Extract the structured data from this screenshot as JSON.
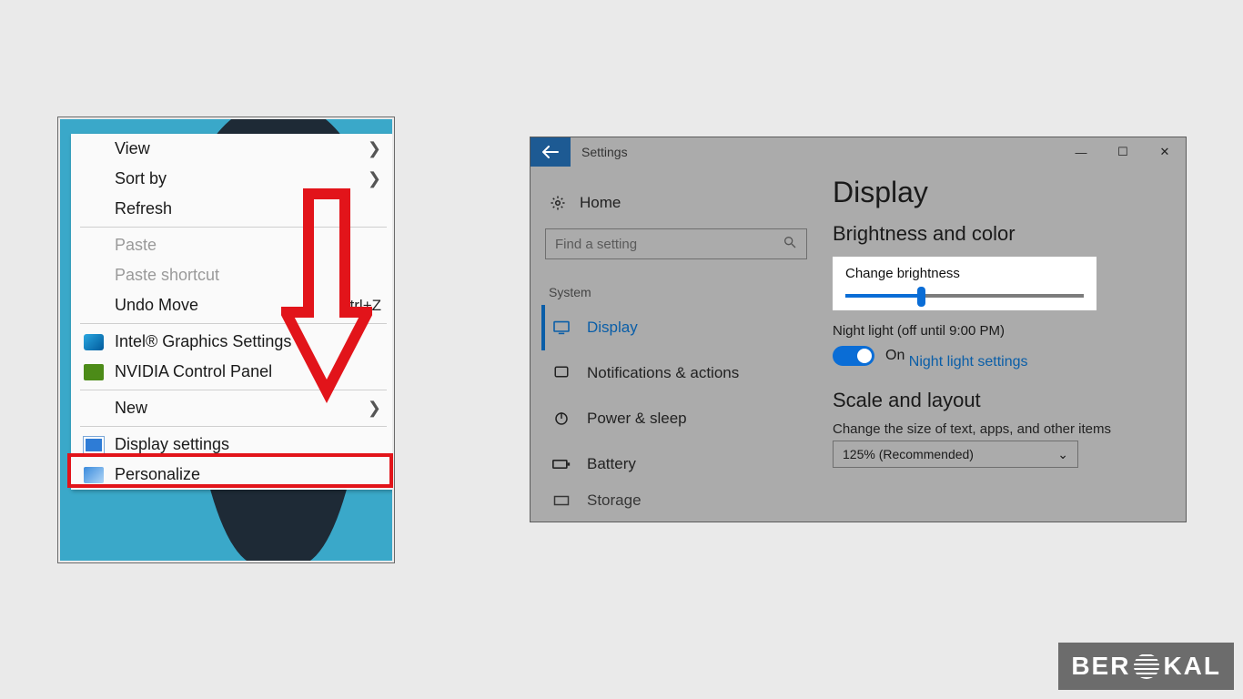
{
  "context_menu": {
    "items": [
      {
        "label": "View",
        "has_submenu": true
      },
      {
        "label": "Sort by",
        "has_submenu": true
      },
      {
        "label": "Refresh"
      }
    ],
    "items2": [
      {
        "label": "Paste",
        "disabled": true
      },
      {
        "label": "Paste shortcut",
        "disabled": true
      },
      {
        "label": "Undo Move",
        "shortcut": "Ctrl+Z"
      }
    ],
    "items3": [
      {
        "label": "Intel® Graphics Settings",
        "icon": "intel"
      },
      {
        "label": "NVIDIA Control Panel",
        "icon": "nvidia"
      }
    ],
    "items4": [
      {
        "label": "New",
        "has_submenu": true
      }
    ],
    "items5": [
      {
        "label": "Display settings",
        "icon": "display",
        "highlighted": true
      },
      {
        "label": "Personalize",
        "icon": "pers"
      }
    ]
  },
  "settings": {
    "title": "Settings",
    "home": "Home",
    "search_placeholder": "Find a setting",
    "category": "System",
    "nav": [
      {
        "label": "Display",
        "active": true,
        "icon": "monitor"
      },
      {
        "label": "Notifications & actions",
        "icon": "notif"
      },
      {
        "label": "Power & sleep",
        "icon": "power"
      },
      {
        "label": "Battery",
        "icon": "battery"
      },
      {
        "label": "Storage",
        "icon": "storage"
      }
    ],
    "page_heading": "Display",
    "section1": "Brightness and color",
    "brightness_label": "Change brightness",
    "brightness_percent": 30,
    "night_light_label": "Night light (off until 9:00 PM)",
    "toggle_state": "On",
    "night_light_link": "Night light settings",
    "section2": "Scale and layout",
    "scale_desc": "Change the size of text, apps, and other items",
    "scale_value": "125% (Recommended)"
  },
  "watermark": {
    "prefix": "BER",
    "suffix": "KAL"
  }
}
